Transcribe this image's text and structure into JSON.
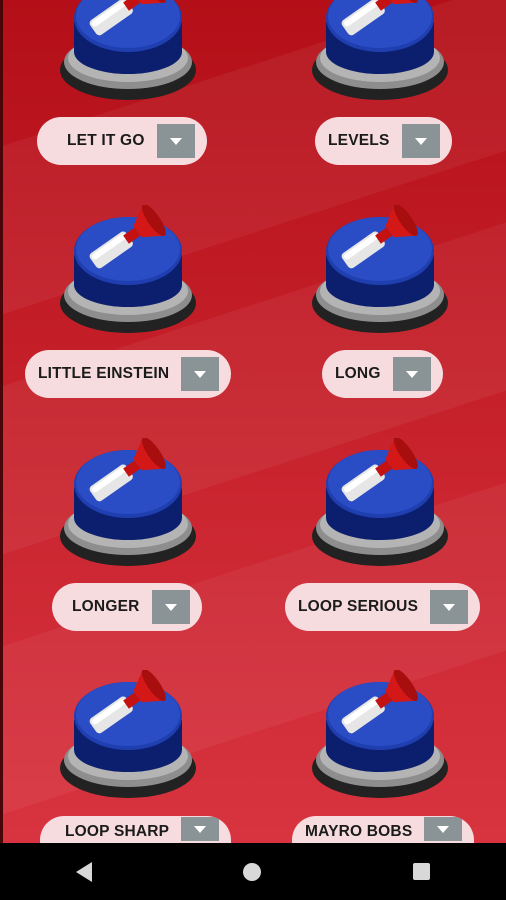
{
  "buttons": [
    {
      "label": "LET IT GO"
    },
    {
      "label": "LEVELS"
    },
    {
      "label": "LITTLE EINSTEIN"
    },
    {
      "label": "LONG"
    },
    {
      "label": "LONGER"
    },
    {
      "label": "LOOP SERIOUS"
    },
    {
      "label": "LOOP SHARP"
    },
    {
      "label": "MAYRO BOBS"
    }
  ],
  "icons": {
    "sound_button": "air-horn-button-icon",
    "dropdown": "chevron-down-icon",
    "nav_back": "back-triangle-icon",
    "nav_home": "home-circle-icon",
    "nav_recent": "recent-apps-square-icon"
  },
  "colors": {
    "background": "#c5202a",
    "pill": "#f6dcdf",
    "dropdown": "#8a9395",
    "button_blue": "#1f3fb0",
    "navbar": "#000000"
  }
}
